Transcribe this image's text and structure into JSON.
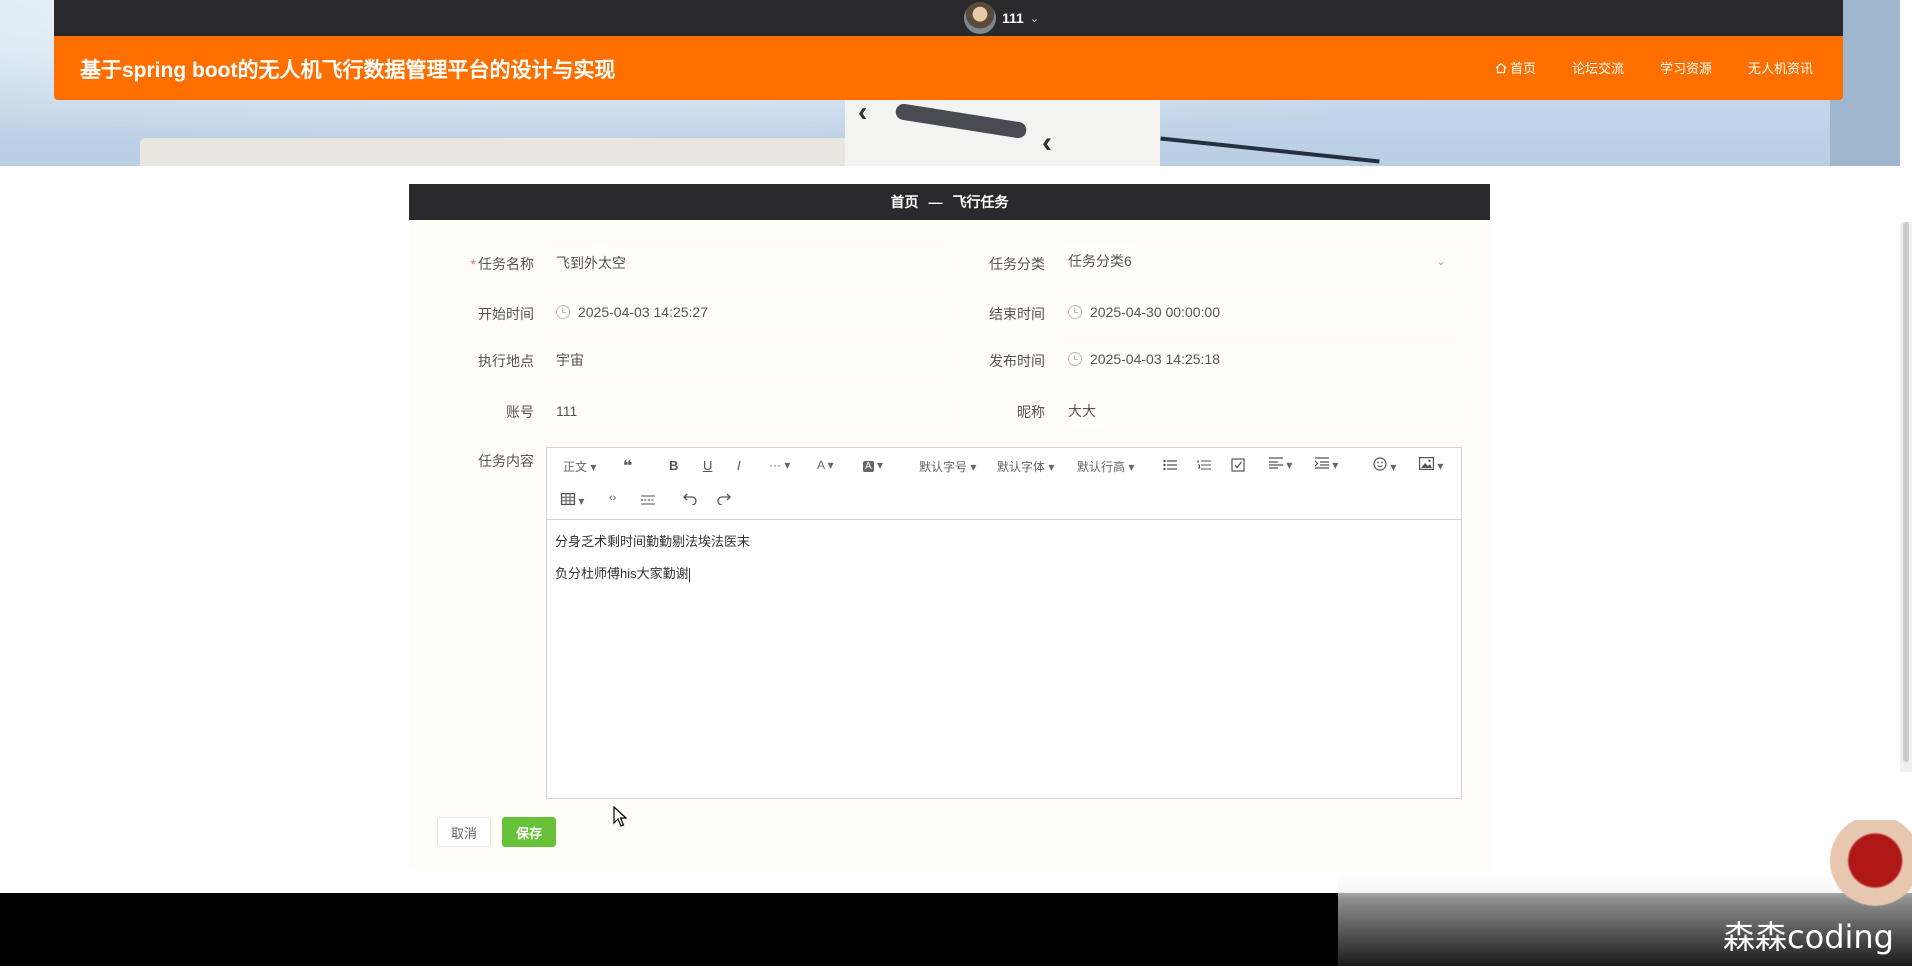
{
  "topbar": {
    "username": "111"
  },
  "header": {
    "site_title": "基于spring boot的无人机飞行数据管理平台的设计与实现",
    "nav": [
      {
        "label": "首页",
        "icon": "home-icon"
      },
      {
        "label": "论坛交流"
      },
      {
        "label": "学习资源"
      },
      {
        "label": "无人机资讯"
      }
    ],
    "accent_color": "#ff6f00"
  },
  "breadcrumb": {
    "home": "首页",
    "separator": "—",
    "current": "飞行任务"
  },
  "form": {
    "task_name_label": "任务名称",
    "task_name_value": "飞到外太空",
    "task_category_label": "任务分类",
    "task_category_value": "任务分类6",
    "start_time_label": "开始时间",
    "start_time_value": "2025-04-03 14:25:27",
    "end_time_label": "结束时间",
    "end_time_value": "2025-04-30 00:00:00",
    "location_label": "执行地点",
    "location_value": "宇宙",
    "publish_time_label": "发布时间",
    "publish_time_value": "2025-04-03 14:25:18",
    "account_label": "账号",
    "account_value": "111",
    "nickname_label": "昵称",
    "nickname_value": "大大",
    "content_label": "任务内容"
  },
  "editor": {
    "toolbar": {
      "paragraph": "正文",
      "quote_icon": "❝",
      "bold": "B",
      "underline": "U",
      "italic": "I",
      "more": "···",
      "font_color": "A",
      "bg_color": "A",
      "font_size": "默认字号",
      "font_family": "默认字体",
      "line_height": "默认行高"
    },
    "lines": [
      "分身乏术剩时间勤勤剔法埃法医末",
      "负分杜师傅his大家勤谢"
    ]
  },
  "buttons": {
    "cancel": "取消",
    "save": "保存",
    "save_color": "#67c23a"
  },
  "watermark": "森森coding"
}
